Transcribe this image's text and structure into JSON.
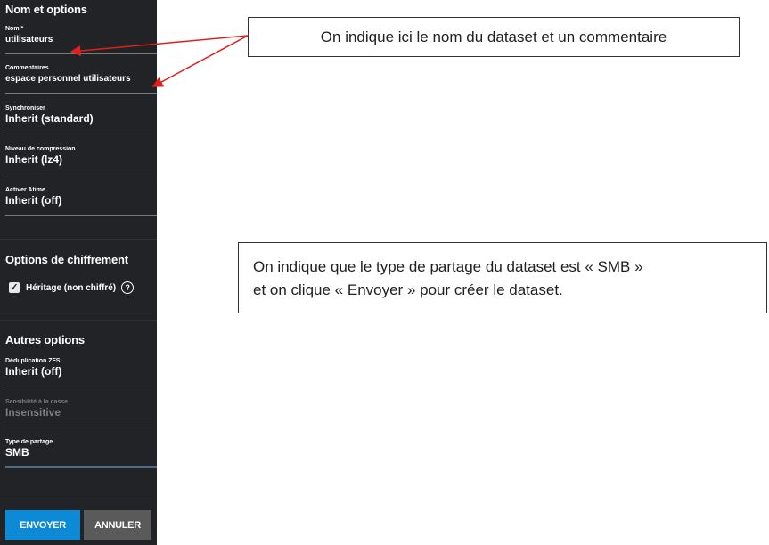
{
  "panel": {
    "section_name": "Nom et options",
    "fields": {
      "name": {
        "label": "Nom *",
        "value": "utilisateurs"
      },
      "comments": {
        "label": "Commentaires",
        "value": "espace personnel utilisateurs"
      },
      "sync": {
        "label": "Synchroniser",
        "value": "Inherit (standard)"
      },
      "compression": {
        "label": "Niveau de compression",
        "value": "Inherit (lz4)"
      },
      "atime": {
        "label": "Activer Atime",
        "value": "Inherit (off)"
      }
    },
    "encryption": {
      "title": "Options de chiffrement",
      "checkbox_label": "Héritage (non chiffré)",
      "checked": true
    },
    "other": {
      "title": "Autres options",
      "dedup": {
        "label": "Déduplication ZFS",
        "value": "Inherit (off)"
      },
      "case": {
        "label": "Sensibilité à la casse",
        "value": "Insensitive"
      },
      "share": {
        "label": "Type de partage",
        "value": "SMB"
      }
    },
    "buttons": {
      "submit": "ENVOYER",
      "cancel": "ANNULER"
    }
  },
  "callouts": {
    "first": "On indique ici le nom du dataset et un commentaire",
    "second_line1": "On indique que le type de partage du dataset est « SMB »",
    "second_line2": "et on clique « Envoyer » pour créer le dataset."
  },
  "colors": {
    "panel_bg": "#222326",
    "submit": "#0d8ad6",
    "cancel": "#5a5a5a",
    "arrow": "#e0201c"
  }
}
